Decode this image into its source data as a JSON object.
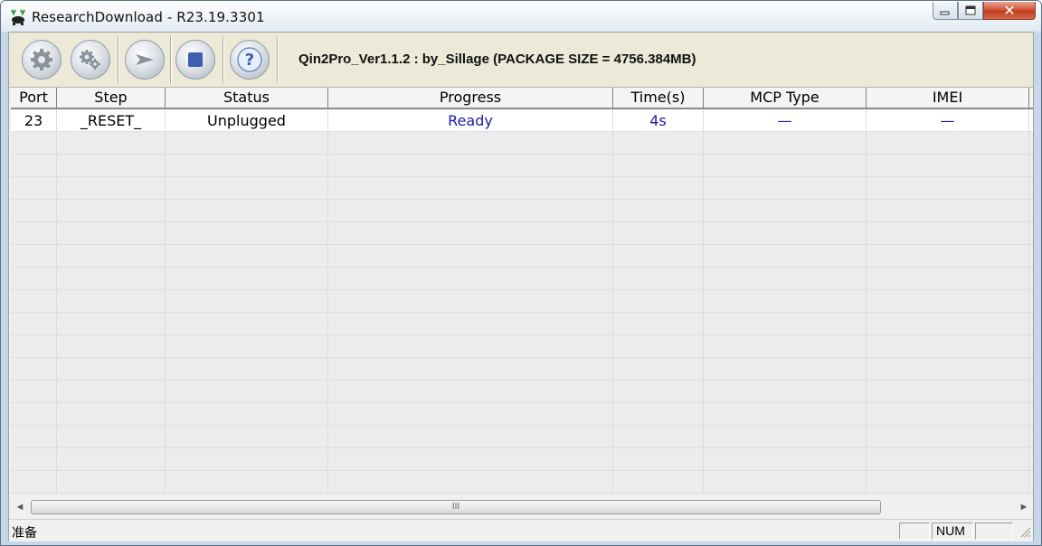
{
  "window": {
    "title": "ResearchDownload - R23.19.3301",
    "minimize_icon": "minimize-icon",
    "maximize_icon": "maximize-icon",
    "close_label": "✕"
  },
  "toolbar": {
    "buttons": [
      {
        "name": "load-packet-button",
        "icon": "gear-icon"
      },
      {
        "name": "settings-button",
        "icon": "gears-icon"
      },
      {
        "name": "start-download-button",
        "icon": "arrow-right-icon"
      },
      {
        "name": "stop-download-button",
        "icon": "stop-icon"
      },
      {
        "name": "help-button",
        "icon": "question-icon"
      }
    ],
    "package_info": "Qin2Pro_Ver1.1.2 : by_Sillage (PACKAGE SIZE = 4756.384MB)"
  },
  "grid": {
    "columns": [
      "Port",
      "Step",
      "Status",
      "Progress",
      "Time(s)",
      "MCP Type",
      "IMEI"
    ],
    "rows": [
      {
        "port": "23",
        "step": "_RESET_",
        "status": "Unplugged",
        "progress": "Ready",
        "time": "4s",
        "mcp_type": "—",
        "imei": "—"
      }
    ]
  },
  "scrollbar": {
    "left_arrow": "◄",
    "right_arrow": "►",
    "thumb_grip": "III"
  },
  "statusbar": {
    "text": "准备",
    "num": "NUM"
  },
  "colors": {
    "toolbar_bg": "#ece9d8",
    "value_blue": "#1a1aa8"
  }
}
